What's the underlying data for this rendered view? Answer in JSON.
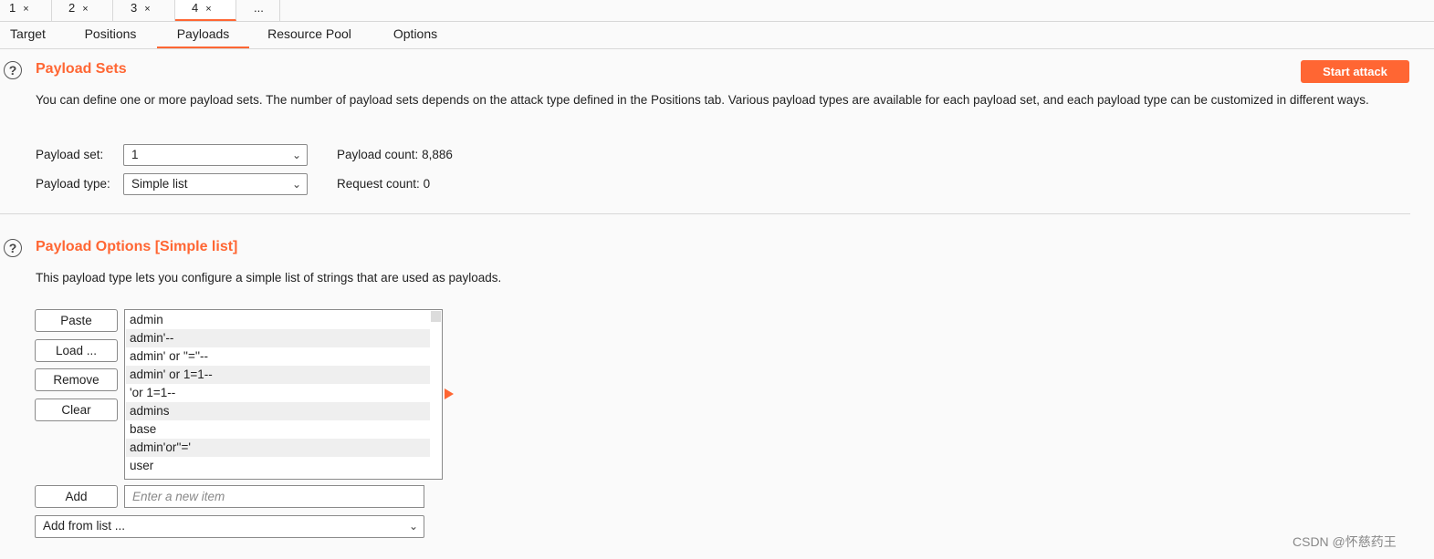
{
  "attack_tabs": [
    {
      "label": "1",
      "close": "×"
    },
    {
      "label": "2",
      "close": "×"
    },
    {
      "label": "3",
      "close": "×"
    },
    {
      "label": "4",
      "close": "×"
    },
    {
      "label": "...",
      "close": ""
    }
  ],
  "sub_tabs": [
    "Target",
    "Positions",
    "Payloads",
    "Resource Pool",
    "Options"
  ],
  "active_sub_tab": "Payloads",
  "accent_color": "#ff6633",
  "payload_sets": {
    "help_icon": "question-circle-icon",
    "title": "Payload Sets",
    "start_attack": "Start attack",
    "description": "You can define one or more payload sets. The number of payload sets depends on the attack type defined in the Positions tab. Various payload types are available for each payload set, and each payload type can be customized in different ways.",
    "payload_set_label": "Payload set:",
    "payload_set_value": "1",
    "payload_type_label": "Payload type:",
    "payload_type_value": "Simple list",
    "payload_count_label": "Payload count:",
    "payload_count_value": "8,886",
    "request_count_label": "Request count:",
    "request_count_value": "0"
  },
  "payload_options": {
    "help_icon": "question-circle-icon",
    "title": "Payload Options [Simple list]",
    "description": "This payload type lets you configure a simple list of strings that are used as payloads.",
    "buttons": {
      "paste": "Paste",
      "load": "Load ...",
      "remove": "Remove",
      "clear": "Clear",
      "add": "Add"
    },
    "items": [
      "admin",
      "admin'--",
      "admin' or ''=''--",
      "admin' or 1=1--",
      "'or 1=1--",
      "admins",
      "base",
      "admin'or''='",
      "user"
    ],
    "add_placeholder": "Enter a new item",
    "add_from_list": "Add from list ..."
  },
  "watermark": "CSDN @怀慈药王"
}
